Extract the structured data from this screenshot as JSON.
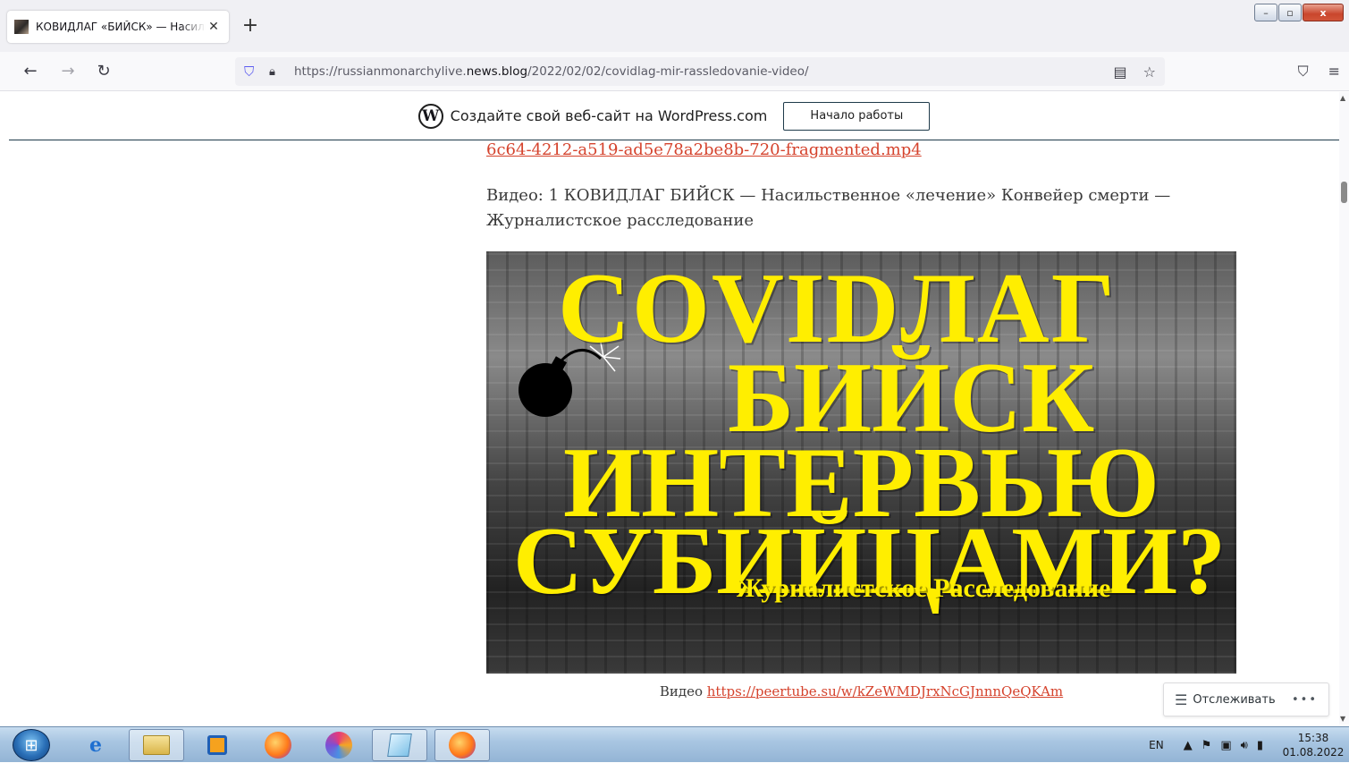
{
  "browser": {
    "tab_title": "КОВИДЛАГ «БИЙСК» — Насильственное «лечение»",
    "tab_close": "✕",
    "new_tab": "+",
    "url_prefix": "https://russianmonarchylive.",
    "url_host": "news.blog",
    "url_path": "/2022/02/02/covidlag-mir-rassledovanie-video/",
    "icons": [
      "back-icon",
      "forward-icon",
      "reload-icon",
      "shield-icon",
      "lock-icon",
      "reader-icon",
      "bookmark-star-icon",
      "pocket-icon",
      "menu-icon"
    ],
    "window_controls": {
      "minimize": "–",
      "maximize": "▫",
      "close": "x"
    }
  },
  "wp_banner": {
    "logo": "W",
    "text": "Создайте свой веб-сайт на WordPress.com",
    "button": "Начало работы"
  },
  "article": {
    "top_link": "6c64-4212-a519-ad5e78a2be8b-720-fragmented.mp4",
    "paragraph": "Видео: 1 КОВИДЛАГ БИЙСК — Насильственное «лечение» Конвейер смерти — Журналистское расследование",
    "poster": {
      "line1": "COVIDЛАГ",
      "line2": "БИЙСК",
      "line3": "ИНТЕРВЬЮ",
      "line4": "СУБИЙЦАМИ?",
      "line5": "Журналистское Расследование"
    },
    "caption_label": "Видео ",
    "caption_link": "https://peertube.su/w/kZeWMDJrxNcGJnnnQeQKAm"
  },
  "follow": {
    "label": "Отслеживать",
    "more": "•••"
  },
  "taskbar": {
    "apps": [
      "internet-explorer-icon",
      "file-explorer-icon",
      "media-player-icon",
      "firefox-icon",
      "app-swirl-icon",
      "notepad-icon",
      "firefox-active-icon"
    ],
    "lang": "EN",
    "time": "15:38",
    "date": "01.08.2022"
  }
}
